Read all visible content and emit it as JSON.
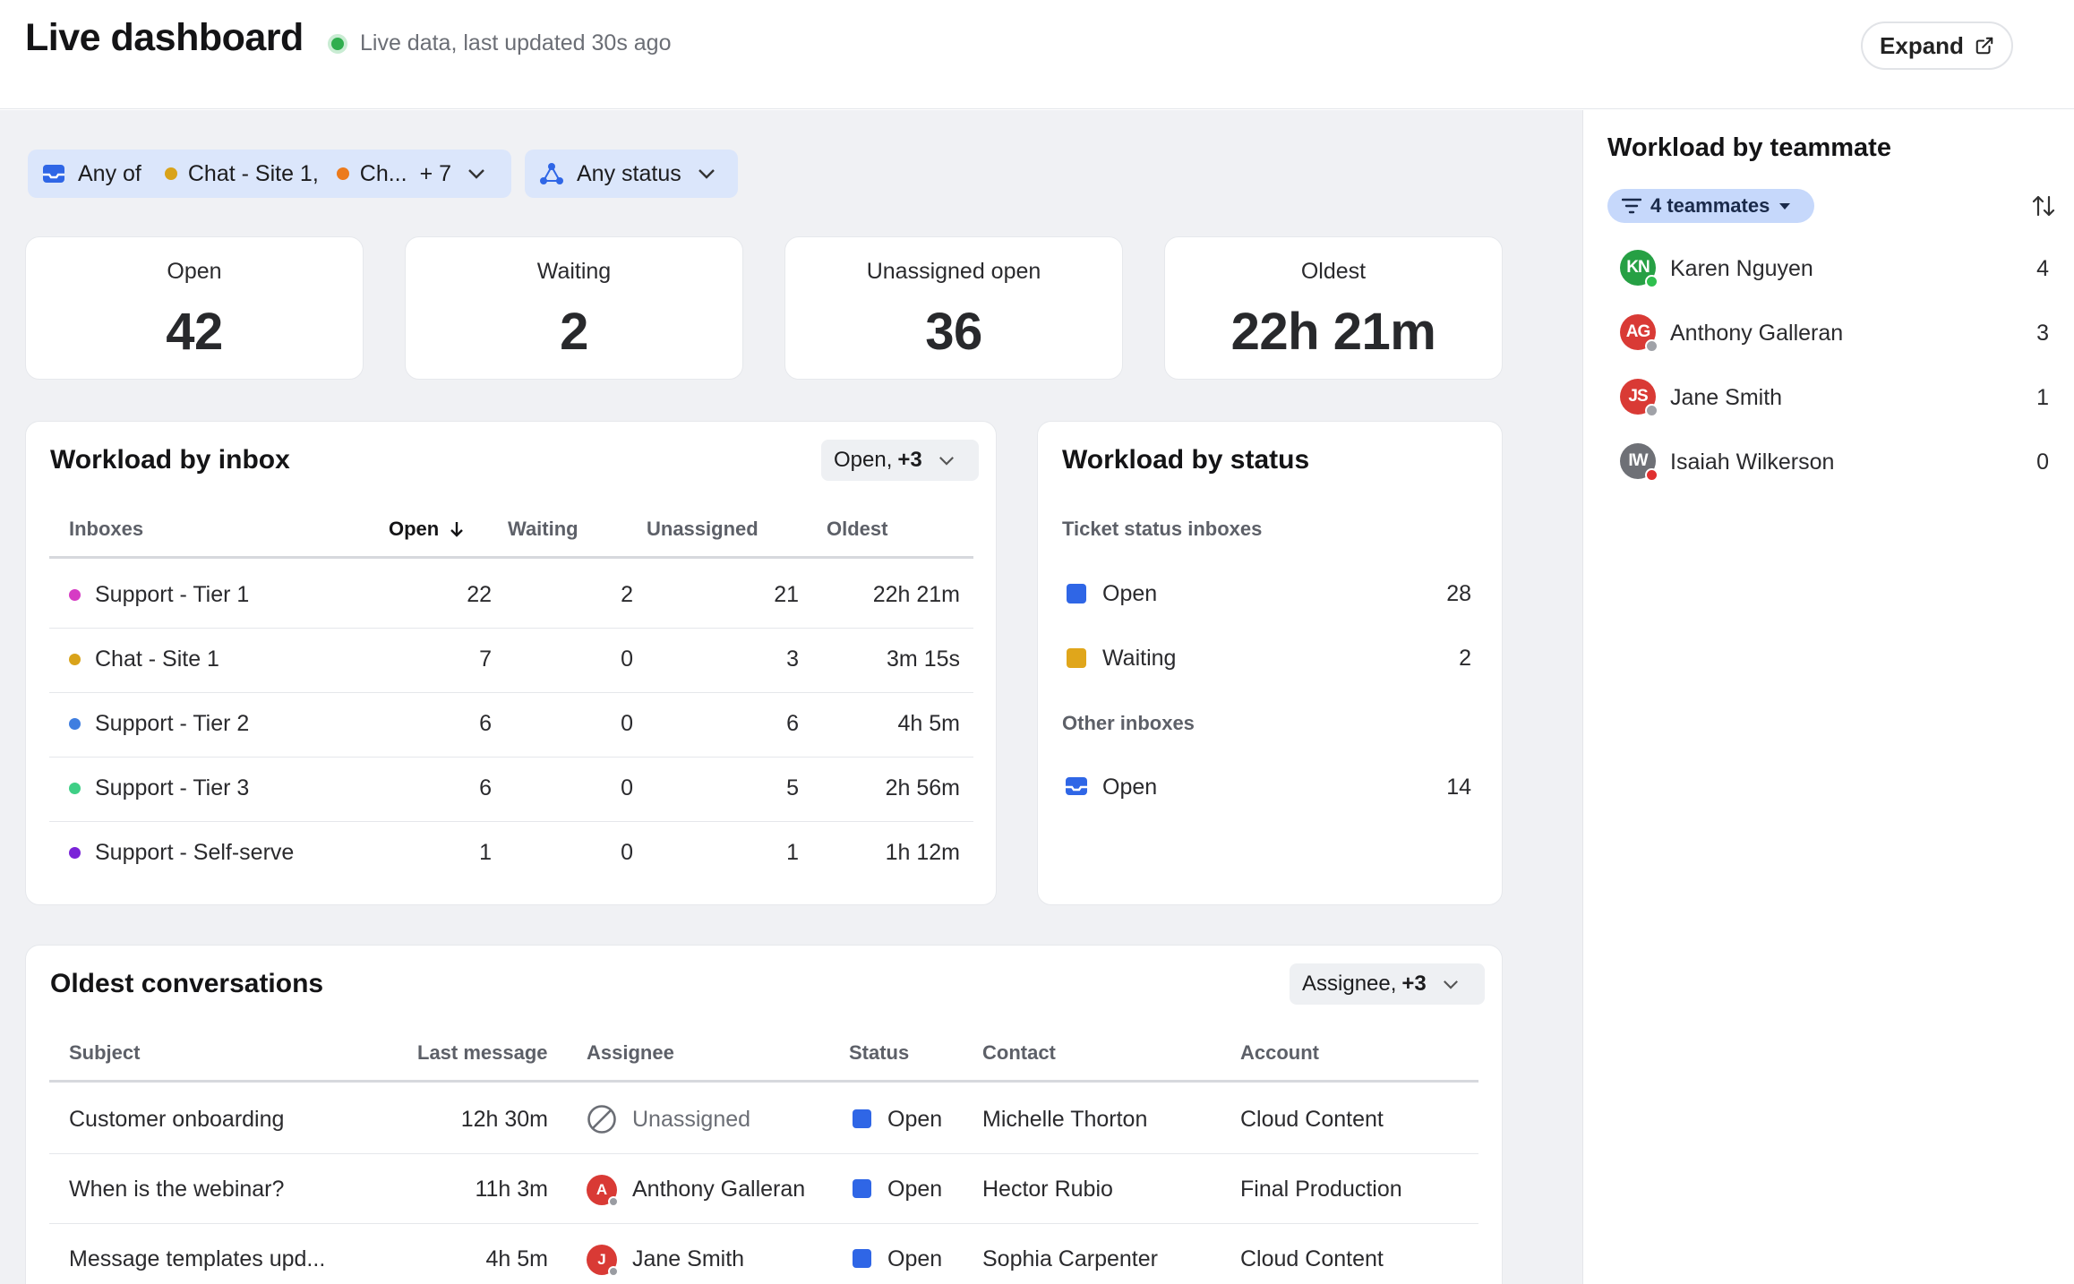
{
  "header": {
    "title": "Live dashboard",
    "status_text": "Live data, last updated 30s ago",
    "expand_label": "Expand"
  },
  "filters": {
    "inbox": {
      "prefix": "Any of",
      "item1": "Chat - Site 1,",
      "item2": "Ch...",
      "more": "+ 7"
    },
    "status": {
      "label": "Any status"
    }
  },
  "stats": [
    {
      "label": "Open",
      "value": "42"
    },
    {
      "label": "Waiting",
      "value": "2"
    },
    {
      "label": "Unassigned open",
      "value": "36"
    },
    {
      "label": "Oldest",
      "value": "22h 21m"
    }
  ],
  "inbox_card": {
    "title": "Workload by inbox",
    "select_label": "Open,",
    "select_more": "+3",
    "columns": [
      "Inboxes",
      "Open",
      "Waiting",
      "Unassigned",
      "Oldest"
    ],
    "sort_column": "Open",
    "rows": [
      {
        "name": "Support - Tier 1",
        "color": "#d63cc4",
        "open": "22",
        "waiting": "2",
        "unassigned": "21",
        "oldest": "22h 21m"
      },
      {
        "name": "Chat - Site 1",
        "color": "#d9a31a",
        "open": "7",
        "waiting": "0",
        "unassigned": "3",
        "oldest": "3m 15s"
      },
      {
        "name": "Support - Tier 2",
        "color": "#3f7ee0",
        "open": "6",
        "waiting": "0",
        "unassigned": "6",
        "oldest": "4h 5m"
      },
      {
        "name": "Support - Tier 3",
        "color": "#3fcf86",
        "open": "6",
        "waiting": "0",
        "unassigned": "5",
        "oldest": "2h 56m"
      },
      {
        "name": "Support - Self-serve",
        "color": "#7a24d8",
        "open": "1",
        "waiting": "0",
        "unassigned": "1",
        "oldest": "1h 12m"
      }
    ]
  },
  "status_card": {
    "title": "Workload by status",
    "section1": "Ticket status inboxes",
    "section2": "Other inboxes",
    "rows": [
      {
        "label": "Open",
        "count": "28",
        "color": "#2f66e6"
      },
      {
        "label": "Waiting",
        "count": "2",
        "color": "#e0a61b"
      },
      {
        "label": "Open",
        "count": "14",
        "icon": "inbox-icon"
      }
    ]
  },
  "conversations": {
    "title": "Oldest conversations",
    "select_label": "Assignee,",
    "select_more": "+3",
    "columns": [
      "Subject",
      "Last message",
      "Assignee",
      "Status",
      "Contact",
      "Account"
    ],
    "rows": [
      {
        "subject": "Customer onboarding",
        "last": "12h 30m",
        "assignee": "Unassigned",
        "avatar": "",
        "avatar_color": "",
        "status": "Open",
        "contact": "Michelle Thorton",
        "account": "Cloud Content"
      },
      {
        "subject": "When is the webinar?",
        "last": "11h 3m",
        "assignee": "Anthony Galleran",
        "avatar": "A",
        "avatar_color": "#d93a35",
        "status": "Open",
        "contact": "Hector Rubio",
        "account": "Final Production"
      },
      {
        "subject": "Message templates upd...",
        "last": "4h 5m",
        "assignee": "Jane Smith",
        "avatar": "J",
        "avatar_color": "#d93a35",
        "status": "Open",
        "contact": "Sophia Carpenter",
        "account": "Cloud Content"
      }
    ]
  },
  "teammates": {
    "title": "Workload by teammate",
    "filter_label": "4 teammates",
    "people": [
      {
        "initials": "KN",
        "name": "Karen Nguyen",
        "count": "4",
        "color": "#26a044",
        "presence": "#2fbf4e"
      },
      {
        "initials": "AG",
        "name": "Anthony Galleran",
        "count": "3",
        "color": "#d93a35",
        "presence": "#a0a2a8"
      },
      {
        "initials": "JS",
        "name": "Jane Smith",
        "count": "1",
        "color": "#d93a35",
        "presence": "#a0a2a8"
      },
      {
        "initials": "IW",
        "name": "Isaiah Wilkerson",
        "count": "0",
        "color": "#6e7076",
        "presence": "#e03030"
      }
    ]
  },
  "colors": {
    "accent": "#2f66e6",
    "live": "#2fae4e",
    "chip_bg": "#dbe6fb"
  }
}
